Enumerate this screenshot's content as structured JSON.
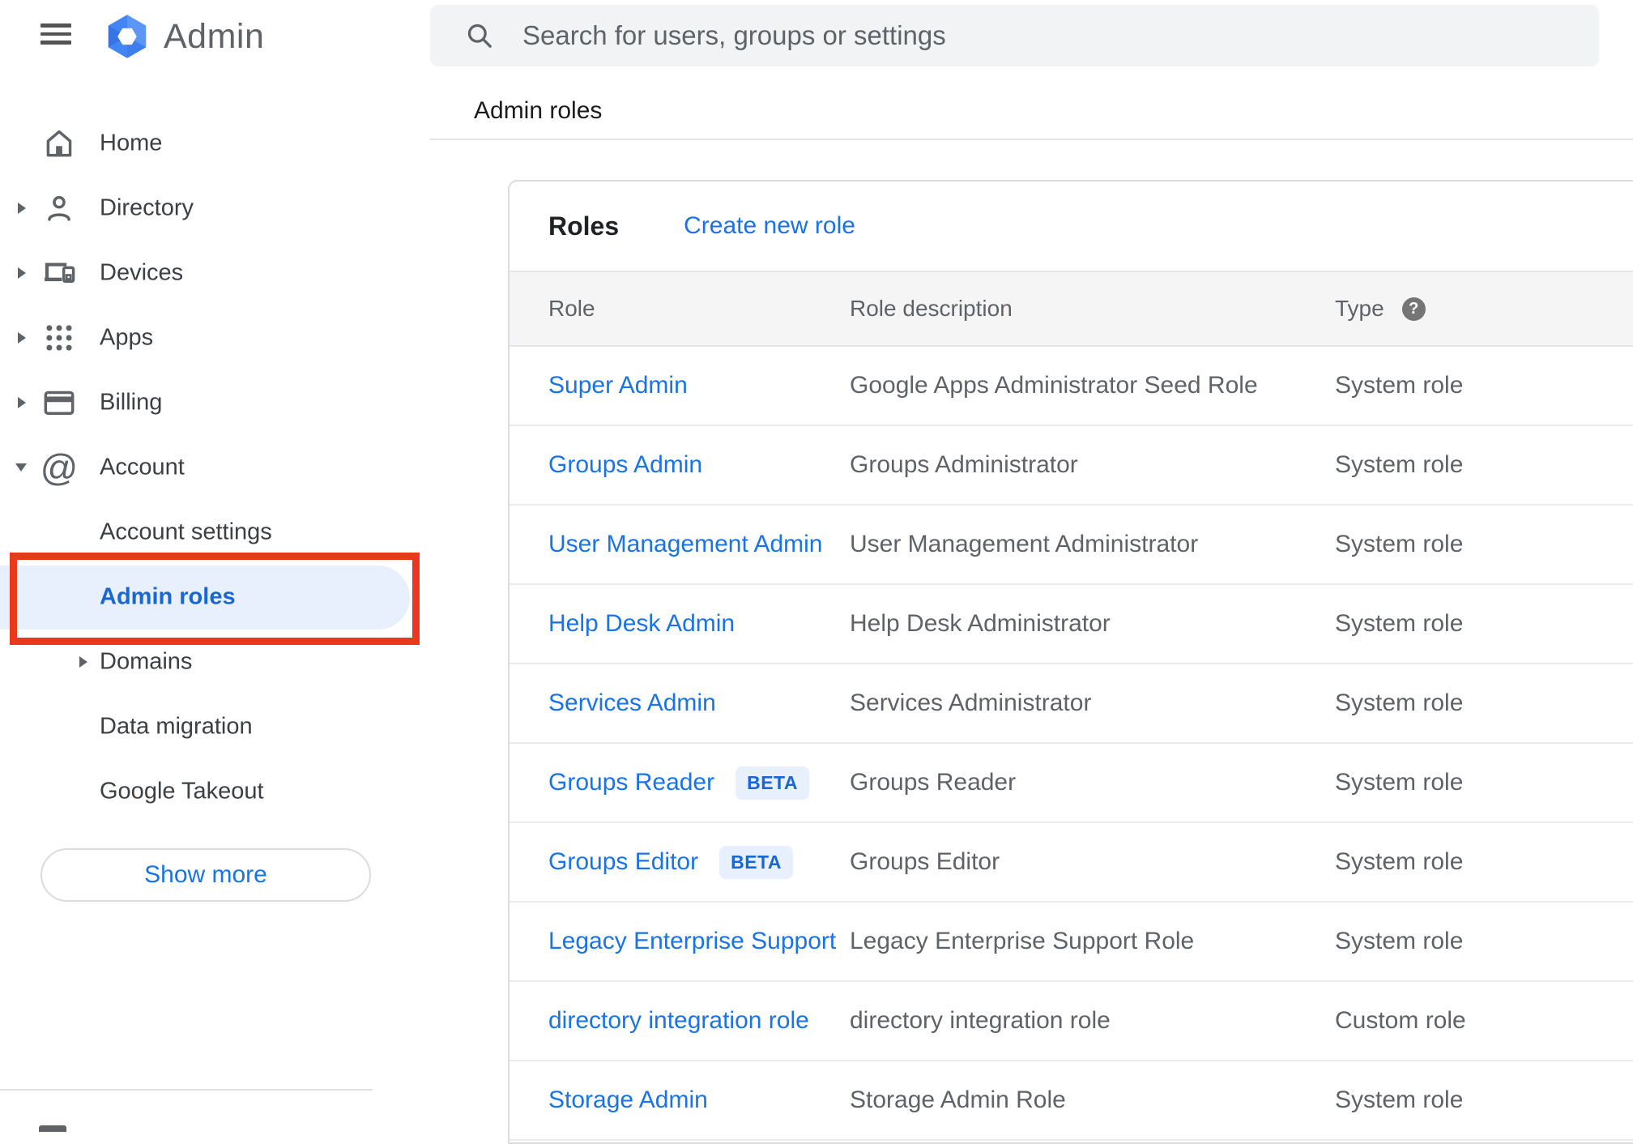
{
  "topbar": {
    "app_title": "Admin"
  },
  "search": {
    "placeholder": "Search for users, groups or settings"
  },
  "breadcrumb": {
    "label": "Admin roles"
  },
  "sidebar": {
    "items": [
      {
        "label": "Home"
      },
      {
        "label": "Directory"
      },
      {
        "label": "Devices"
      },
      {
        "label": "Apps"
      },
      {
        "label": "Billing"
      },
      {
        "label": "Account"
      },
      {
        "label": "Account settings"
      },
      {
        "label": "Admin roles",
        "selected": true
      },
      {
        "label": "Domains"
      },
      {
        "label": "Data migration"
      },
      {
        "label": "Google Takeout"
      }
    ],
    "account_icon_glyph": "@",
    "show_more_label": "Show more",
    "selected_item": "Admin roles"
  },
  "roles_panel": {
    "title": "Roles",
    "create_link_label": "Create new role",
    "columns": {
      "role": "Role",
      "description": "Role description",
      "type": "Type"
    },
    "type_help_glyph": "?",
    "rows": [
      {
        "role": "Super Admin",
        "description": "Google Apps Administrator Seed Role",
        "type": "System role"
      },
      {
        "role": "Groups Admin",
        "description": "Groups Administrator",
        "type": "System role"
      },
      {
        "role": "User Management Admin",
        "description": "User Management Administrator",
        "type": "System role"
      },
      {
        "role": "Help Desk Admin",
        "description": "Help Desk Administrator",
        "type": "System role"
      },
      {
        "role": "Services Admin",
        "description": "Services Administrator",
        "type": "System role"
      },
      {
        "role": "Groups Reader",
        "beta_label": "BETA",
        "description": "Groups Reader",
        "type": "System role"
      },
      {
        "role": "Groups Editor",
        "beta_label": "BETA",
        "description": "Groups Editor",
        "type": "System role"
      },
      {
        "role": "Legacy Enterprise Support",
        "description": "Legacy Enterprise Support Role",
        "type": "System role"
      },
      {
        "role": "directory integration role",
        "description": "directory integration role",
        "type": "Custom role"
      },
      {
        "role": "Storage Admin",
        "description": "Storage Admin Role",
        "type": "System role"
      }
    ]
  },
  "colors": {
    "link_blue": "#1a73e8",
    "selected_blue": "#1967d2",
    "highlight_bg": "#e8f0fe",
    "annotation_red": "#e8391d",
    "beta_bg": "#e8f0fe",
    "beta_text": "#1967d2",
    "search_bg": "#f1f3f4",
    "table_header_bg": "#f5f5f5"
  }
}
